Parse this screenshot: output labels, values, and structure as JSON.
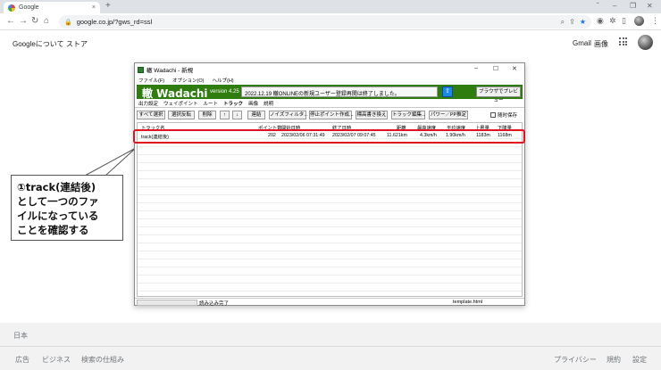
{
  "browser": {
    "tab_title": "Google",
    "tab_close": "×",
    "new_tab": "+",
    "window_controls": [
      "ˇ",
      "–",
      "❐",
      "✕"
    ],
    "nav": [
      "←",
      "→",
      "↻",
      "⌂"
    ],
    "url": "google.co.jp/?gws_rd=ssl",
    "icons": [
      "search-icon",
      "share-icon",
      "star-icon",
      "extension-icon",
      "puzzle-icon",
      "sidebar-icon"
    ]
  },
  "google": {
    "left_links": [
      "Googleについて",
      "ストア"
    ],
    "right_links": [
      "Gmail",
      "画像"
    ],
    "country": "日本",
    "footer_left": [
      "広告",
      "ビジネス",
      "検索の仕組み"
    ],
    "footer_right": [
      "プライバシー",
      "規約",
      "設定"
    ]
  },
  "callout": {
    "text": "①track(連結後)\nとして一つのファ\nイルになっている\nことを確認する"
  },
  "app": {
    "title": "轍 Wadachi - 新規",
    "controls": [
      "–",
      "☐",
      "✕"
    ],
    "menu": [
      "ファイル(F)",
      "オプション(O)",
      "ヘルプ(H)"
    ],
    "logo": "轍 Wadachi",
    "version": "version 4.25",
    "news": "2022.12.19 轍ONLINEの新規ユーザー登録再開は終了しました。",
    "upload_icon": "⇧",
    "browser_preview": "ブラウザでプレビュー",
    "tabs": [
      "出力設定",
      "ウェイポイント",
      "ルート",
      "トラック",
      "画像",
      "説明"
    ],
    "active_tab": "トラック",
    "buttons": [
      "すべて選択",
      "選択反転",
      "削除",
      "↑",
      "↓",
      "連結",
      "ノイズフィルタ...",
      "停止ポイント作成...",
      "標高書き換え",
      "トラック編集...",
      "パワー／PP推定"
    ],
    "checkbox_label": "随时保存",
    "columns": [
      "トラック名",
      "ポイント数",
      "開始日時",
      "終了日時",
      "距離",
      "最高速度",
      "平均速度",
      "上昇量",
      "下降量"
    ],
    "rows": [
      [
        "track(連結後)",
        "202",
        "2023/02/06 07:31:49",
        "2023/02/07 09:07:45",
        "11.621km",
        "4.3km/h",
        "1.90km/h",
        "1183m",
        "1168m"
      ]
    ],
    "status": [
      "読み込み完了",
      "template.html"
    ]
  }
}
